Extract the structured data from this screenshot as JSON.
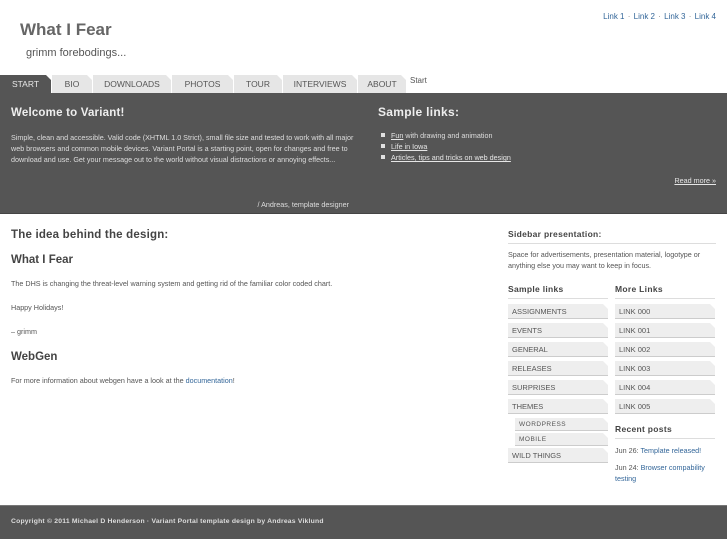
{
  "header": {
    "title": "What I Fear",
    "slogan": "grimm forebodings...",
    "top_links": [
      "Link 1",
      "Link 2",
      "Link 3",
      "Link 4"
    ],
    "top_link_separator": "·"
  },
  "nav": {
    "tabs": [
      {
        "label": "START",
        "active": true
      },
      {
        "label": "BIO",
        "active": false
      },
      {
        "label": "DOWNLOADS",
        "active": false
      },
      {
        "label": "PHOTOS",
        "active": false
      },
      {
        "label": "TOUR",
        "active": false
      },
      {
        "label": "INTERVIEWS",
        "active": false
      },
      {
        "label": "ABOUT",
        "active": false
      }
    ],
    "breadcrumb": "Start"
  },
  "intro": {
    "welcome_title": "Welcome to Variant!",
    "welcome_text": "Simple, clean and accessible. Valid code (XHTML 1.0 Strict), small file size and tested to work with all major web browsers and common mobile devices. Variant Portal is a starting point, open for changes and free to download and use. Get your message out to the world without visual distractions or annoying effects...",
    "signature": "/ Andreas, template designer",
    "sample_title": "Sample links:",
    "sample_links": [
      {
        "link": "Fun",
        "rest": " with drawing and animation"
      },
      {
        "link": "Life in Iowa",
        "rest": ""
      },
      {
        "link": "Articles, tips and tricks on web design",
        "rest": ""
      }
    ],
    "read_more": "Read more »"
  },
  "main": {
    "heading": "The idea behind the design:",
    "subheading": "What I Fear",
    "paragraph1": "The DHS is changing the threat-level warning system and getting rid of the familiar color coded chart.",
    "paragraph2": "Happy Holidays!",
    "paragraph3": "– grimm",
    "webgen_heading": "WebGen",
    "webgen_text_before": "For more information about webgen have a look at the ",
    "webgen_link": "documentation",
    "webgen_text_after": "!"
  },
  "sidebar": {
    "presentation_title": "Sidebar presentation:",
    "presentation_text": "Space for advertisements, presentation material, logotype or anything else you may want to keep in focus.",
    "sample_links_title": "Sample links",
    "sample_links": [
      {
        "label": "ASSIGNMENTS",
        "sub": false
      },
      {
        "label": "EVENTS",
        "sub": false
      },
      {
        "label": "GENERAL",
        "sub": false
      },
      {
        "label": "RELEASES",
        "sub": false
      },
      {
        "label": "SURPRISES",
        "sub": false
      },
      {
        "label": "THEMES",
        "sub": false
      },
      {
        "label": "WORDPRESS",
        "sub": true
      },
      {
        "label": "MOBILE",
        "sub": true
      },
      {
        "label": "WILD THINGS",
        "sub": false
      }
    ],
    "more_links_title": "More Links",
    "more_links": [
      "LINK 000",
      "LINK 001",
      "LINK 002",
      "LINK 003",
      "LINK 004",
      "LINK 005"
    ],
    "recent_posts_title": "Recent posts",
    "recent_posts": [
      {
        "date": "Jun 26: ",
        "title": "Template released!"
      },
      {
        "date": "Jun 24: ",
        "title": "Browser compability testing"
      }
    ]
  },
  "footer": {
    "text": "Copyright © 2011 Michael D Henderson · Variant Portal template design by Andreas Viklund"
  }
}
